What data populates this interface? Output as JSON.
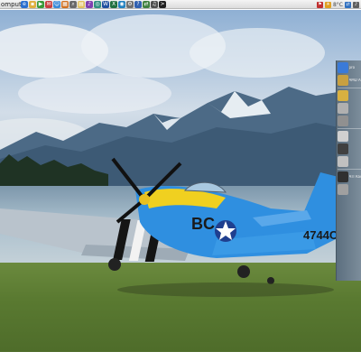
{
  "taskbar": {
    "start_label": "omputer",
    "quicklaunch": [
      {
        "icon": "ie-icon",
        "color": "#2a6fcf",
        "glyph": "e"
      },
      {
        "icon": "folder-icon",
        "color": "#e0b040",
        "glyph": "▪"
      },
      {
        "icon": "media-icon",
        "color": "#3a9a3a",
        "glyph": "▶"
      },
      {
        "icon": "mail-icon",
        "color": "#c84040",
        "glyph": "✉"
      },
      {
        "icon": "messenger-icon",
        "color": "#3a8ad8",
        "glyph": "☺"
      },
      {
        "icon": "calendar-icon",
        "color": "#d07020",
        "glyph": "▦"
      },
      {
        "icon": "search-icon",
        "color": "#6a6a6a",
        "glyph": "⌕"
      },
      {
        "icon": "explorer-icon",
        "color": "#e0c060",
        "glyph": "▤"
      },
      {
        "icon": "music-icon",
        "color": "#8040b0",
        "glyph": "♪"
      },
      {
        "icon": "photo-icon",
        "color": "#309080",
        "glyph": "◎"
      },
      {
        "icon": "word-icon",
        "color": "#2050a0",
        "glyph": "W"
      },
      {
        "icon": "excel-icon",
        "color": "#207040",
        "glyph": "X"
      },
      {
        "icon": "globe-icon",
        "color": "#2080c0",
        "glyph": "◉"
      },
      {
        "icon": "settings-icon",
        "color": "#707070",
        "glyph": "⚙"
      },
      {
        "icon": "help-icon",
        "color": "#3060b0",
        "glyph": "?"
      },
      {
        "icon": "network-icon",
        "color": "#408040",
        "glyph": "⇄"
      },
      {
        "icon": "volume-icon",
        "color": "#505050",
        "glyph": "♫"
      },
      {
        "icon": "terminal-icon",
        "color": "#202020",
        "glyph": ">"
      }
    ],
    "tray": {
      "flag_icon": "flag-icon",
      "weather_icon": "weather-icon",
      "temperature": "8°C",
      "extra_icons": [
        "network-tray-icon",
        "volume-tray-icon"
      ]
    }
  },
  "sidebar": {
    "gadgets": [
      {
        "name": "monitor-gadget",
        "icon": "monitor-icon",
        "label": "pro",
        "color": "#3a7ad8"
      },
      {
        "name": "cpu-gadget",
        "icon": "cpu-icon",
        "label": "AMD Athlon",
        "color": "#c8a040"
      },
      {
        "name": "battery-gadget",
        "icon": "battery-icon",
        "label": "",
        "color": "#d8b040"
      },
      {
        "name": "drive-gadget",
        "icon": "drive-icon",
        "label": "",
        "color": "#b0b0b0"
      },
      {
        "name": "usb-gadget",
        "icon": "usb-icon",
        "label": "",
        "color": "#909090"
      },
      {
        "name": "network-gadget",
        "icon": "network-icon",
        "label": "",
        "color": "#d0d0d0"
      },
      {
        "name": "screen-gadget",
        "icon": "screen-icon",
        "label": "",
        "color": "#404040"
      },
      {
        "name": "drive2-gadget",
        "icon": "drive-icon",
        "label": "",
        "color": "#c0c0c0"
      },
      {
        "name": "ati-gadget",
        "icon": "graphics-icon",
        "label": "ATI Rade",
        "color": "#303030"
      },
      {
        "name": "speaker-gadget",
        "icon": "speaker-icon",
        "label": "",
        "color": "#a0a0a0"
      }
    ]
  },
  "plane": {
    "nose_text": "BC",
    "tail_number": "4744C"
  }
}
